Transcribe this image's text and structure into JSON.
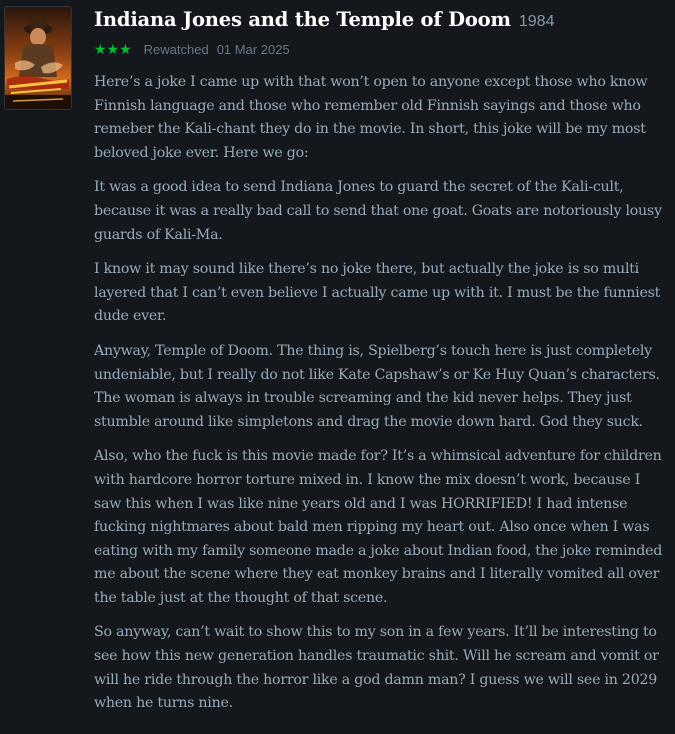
{
  "film": {
    "title": "Indiana Jones and the Temple of Doom",
    "year": "1984",
    "poster_icon": "movie-poster"
  },
  "meta": {
    "rating_stars": "★★★",
    "rating_value": 3,
    "rewatch_label": "Rewatched",
    "date": "01 Mar 2025",
    "star_color": "#00c030"
  },
  "review": {
    "paragraphs": [
      "Here’s a joke I came up with that won’t open to anyone except those who know Finnish language and those who remember old Finnish sayings and those who remeber the Kali-chant they do in the movie. In short, this joke will be my most beloved joke ever. Here we go:",
      "It was a good idea to send Indiana Jones to guard the secret of the Kali-cult, because it was a really bad call to send that one goat. Goats are notoriously lousy guards of Kali-Ma.",
      "I know it may sound like there’s no joke there, but actually the joke is so multi layered that I can’t even believe I actually came up with it. I must be the funniest dude ever.",
      "Anyway, Temple of Doom. The thing is, Spielberg’s touch here is just completely undeniable, but I really do not like Kate Capshaw’s or Ke Huy Quan’s characters. The woman is always in trouble screaming and the kid never helps. They just stumble around like simpletons and drag the movie down hard. God they suck.",
      "Also, who the fuck is this movie made for? It’s a whimsical adventure for children with hardcore horror torture mixed in. I know the mix doesn’t work, because I saw this when I was like nine years old and I was HORRIFIED! I had intense fucking nightmares about bald men ripping my heart out. Also once when I was eating with my family someone made a joke about Indian food, the joke reminded me about the scene where they eat monkey brains and I literally vomited all over the table just at the thought of that scene.",
      "So anyway, can’t wait to show this to my son in a few years. It’ll be interesting to see how this new generation handles traumatic shit. Will he scream and vomit or will he ride through the horror like a god damn man? I guess we will see in 2029 when he turns nine."
    ]
  },
  "colors": {
    "background": "#14181c",
    "title": "#ffffff",
    "body_text": "#99aabb",
    "meta_text": "#667788"
  }
}
